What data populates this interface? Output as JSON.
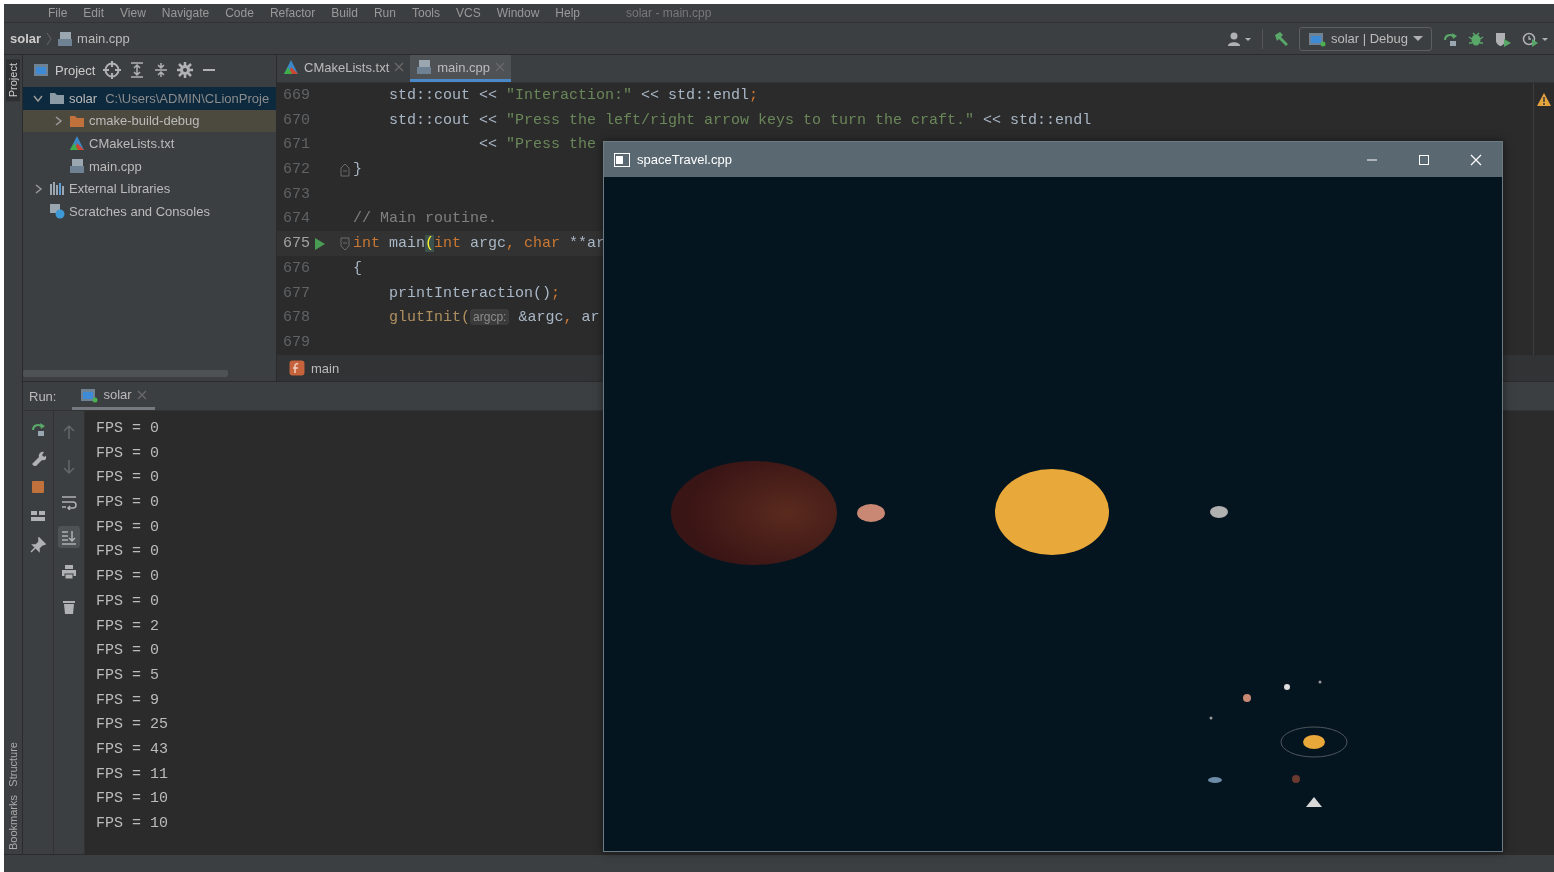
{
  "menu_bar": {
    "items": [
      "File",
      "Edit",
      "View",
      "Navigate",
      "Code",
      "Refactor",
      "Build",
      "Run",
      "Tools",
      "VCS",
      "Window",
      "Help"
    ],
    "title": "solar - main.cpp"
  },
  "nav_bar": {
    "breadcrumb": [
      "solar",
      "main.cpp"
    ],
    "run_config": "solar | Debug"
  },
  "left_stripe": {
    "tabs": [
      {
        "label": "Project",
        "selected": true
      },
      {
        "label": "Structure",
        "selected": false
      },
      {
        "label": "Bookmarks",
        "selected": false
      }
    ]
  },
  "project_panel": {
    "title": "Project",
    "tree": [
      {
        "label": "solar",
        "path": "C:\\Users\\ADMIN\\CLionProje",
        "kind": "folder",
        "expanded": true,
        "selected": true,
        "excluded": false,
        "children": [
          {
            "label": "cmake-build-debug",
            "kind": "folder",
            "expanded": false,
            "selected": false,
            "excluded": true
          },
          {
            "label": "CMakeLists.txt",
            "kind": "cmake",
            "selected": false,
            "excluded": false
          },
          {
            "label": "main.cpp",
            "kind": "cpp",
            "selected": false,
            "excluded": false
          }
        ]
      },
      {
        "label": "External Libraries",
        "kind": "library",
        "expanded": false,
        "selected": false,
        "excluded": false
      },
      {
        "label": "Scratches and Consoles",
        "kind": "scratches",
        "selected": false,
        "excluded": false
      }
    ]
  },
  "editor": {
    "tabs": [
      {
        "label": "CMakeLists.txt",
        "kind": "cmake",
        "selected": false
      },
      {
        "label": "main.cpp",
        "kind": "cpp",
        "selected": true
      }
    ],
    "lines": [
      {
        "number": "669",
        "current": false,
        "run": false,
        "fold_start": false,
        "fold_end": false,
        "tokens": [
          {
            "kind": "plain",
            "text": "    std::cout << "
          },
          {
            "kind": "string",
            "text": "\"Interaction:\""
          },
          {
            "kind": "plain",
            "text": " << std::endl"
          },
          {
            "kind": "keyword",
            "text": ";"
          }
        ]
      },
      {
        "number": "670",
        "current": false,
        "run": false,
        "fold_start": false,
        "fold_end": false,
        "tokens": [
          {
            "kind": "plain",
            "text": "    std::cout << "
          },
          {
            "kind": "string",
            "text": "\"Press the left/right arrow keys to turn the craft.\""
          },
          {
            "kind": "plain",
            "text": " << std::endl"
          }
        ]
      },
      {
        "number": "671",
        "current": false,
        "run": false,
        "fold_start": false,
        "fold_end": false,
        "tokens": [
          {
            "kind": "plain",
            "text": "              << "
          },
          {
            "kind": "string",
            "text": "\"Press the"
          }
        ]
      },
      {
        "number": "672",
        "current": false,
        "run": false,
        "fold_start": false,
        "fold_end": true,
        "tokens": [
          {
            "kind": "plain",
            "text": "}"
          }
        ]
      },
      {
        "number": "673",
        "current": false,
        "run": false,
        "fold_start": false,
        "fold_end": false
      },
      {
        "number": "674",
        "current": false,
        "run": false,
        "fold_start": false,
        "fold_end": false,
        "tokens": [
          {
            "kind": "comment",
            "text": "// Main routine."
          }
        ]
      },
      {
        "number": "675",
        "current": true,
        "run": true,
        "fold_start": true,
        "fold_end": false,
        "tokens": [
          {
            "kind": "keyword",
            "text": "int"
          },
          {
            "kind": "plain",
            "text": " main"
          },
          {
            "kind": "brace",
            "text": "("
          },
          {
            "kind": "keyword",
            "text": "int"
          },
          {
            "kind": "plain",
            "text": " argc"
          },
          {
            "kind": "keyword",
            "text": ", char"
          },
          {
            "kind": "plain",
            "text": " **ar"
          }
        ]
      },
      {
        "number": "676",
        "current": false,
        "run": false,
        "fold_start": false,
        "fold_end": false,
        "tokens": [
          {
            "kind": "plain",
            "text": "{"
          }
        ]
      },
      {
        "number": "677",
        "current": false,
        "run": false,
        "fold_start": false,
        "fold_end": false,
        "tokens": [
          {
            "kind": "plain",
            "text": "    printInteraction()"
          },
          {
            "kind": "keyword",
            "text": ";"
          }
        ]
      },
      {
        "number": "678",
        "current": false,
        "run": false,
        "fold_start": false,
        "fold_end": false,
        "tokens": [
          {
            "kind": "call",
            "text": "    glutInit("
          },
          {
            "kind": "hint",
            "text": "argcp:"
          },
          {
            "kind": "plain",
            "text": " &argc"
          },
          {
            "kind": "keyword",
            "text": ","
          },
          {
            "kind": "plain",
            "text": " ar"
          }
        ]
      },
      {
        "number": "679",
        "current": false,
        "run": false,
        "fold_start": false,
        "fold_end": false
      }
    ],
    "breadcrumb": "main"
  },
  "run_panel": {
    "label": "Run:",
    "tab": {
      "label": "solar",
      "selected": true
    },
    "console_tools": [
      {
        "disabled": true,
        "on": false
      },
      {
        "disabled": true,
        "on": false
      },
      {
        "disabled": false,
        "on": false
      },
      {
        "disabled": false,
        "on": true
      },
      {
        "disabled": false,
        "on": false
      },
      {
        "disabled": false,
        "on": false
      }
    ],
    "output": [
      "FPS = 0",
      "FPS = 0",
      "FPS = 0",
      "FPS = 0",
      "FPS = 0",
      "FPS = 0",
      "FPS = 0",
      "FPS = 0",
      "FPS = 2",
      "FPS = 0",
      "FPS = 5",
      "FPS = 9",
      "FPS = 25",
      "FPS = 43",
      "FPS = 11",
      "FPS = 10",
      "FPS = 10"
    ]
  },
  "app_window": {
    "title": "spaceTravel.cpp"
  }
}
